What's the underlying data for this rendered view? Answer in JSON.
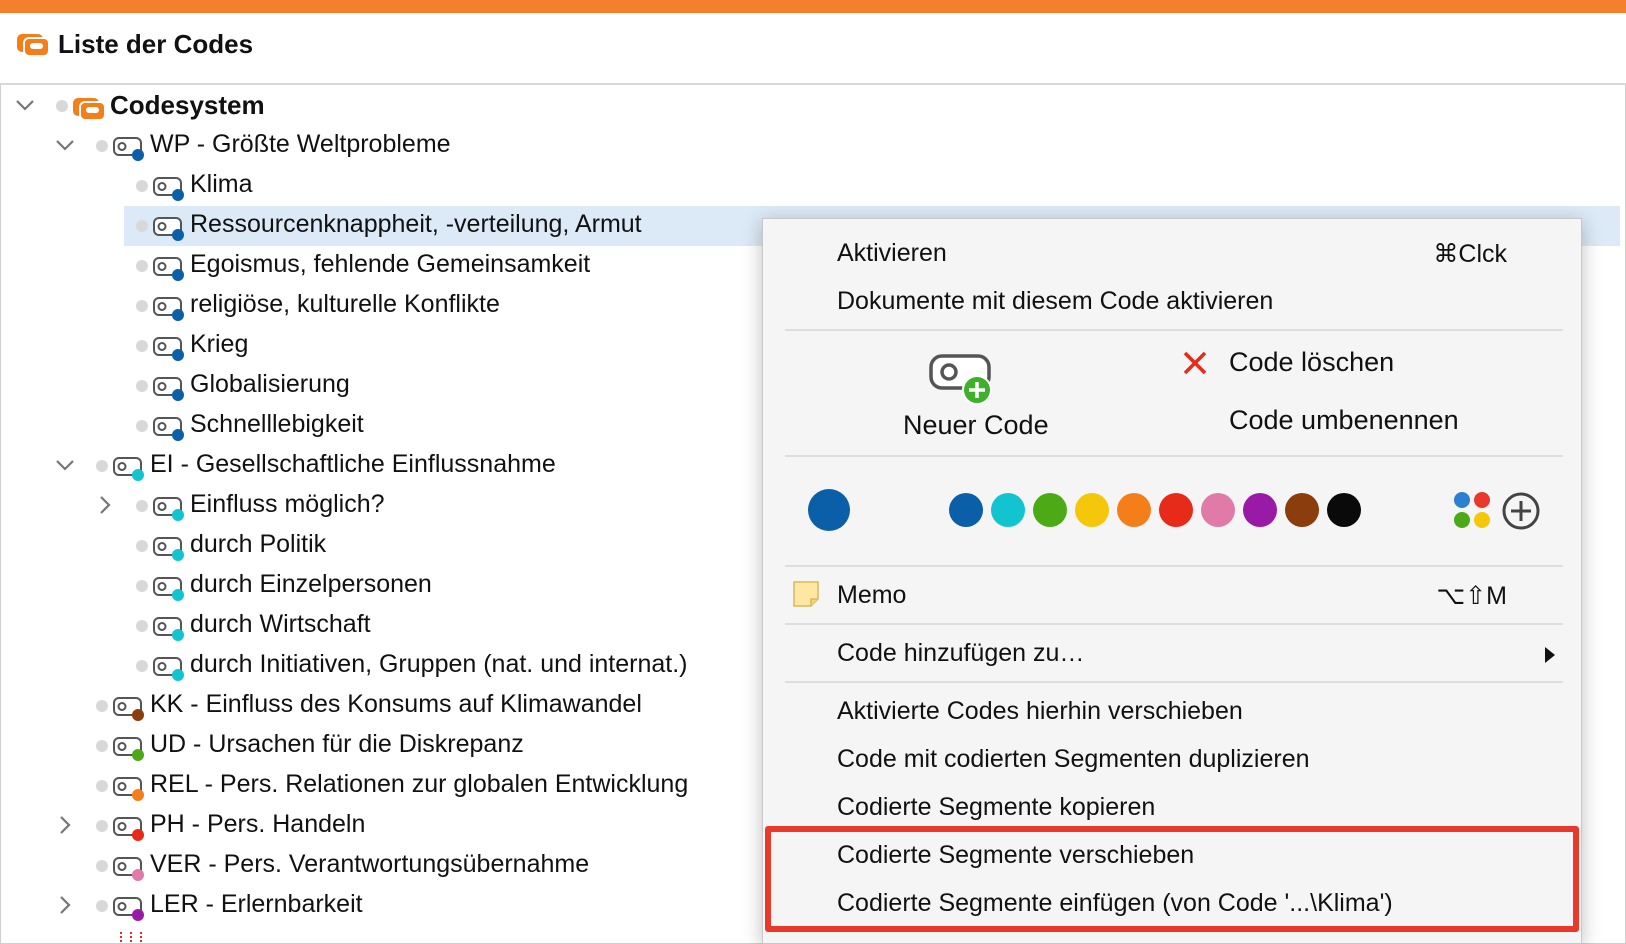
{
  "window": {
    "title": "Liste der Codes"
  },
  "tree": {
    "root": {
      "label": "Codesystem"
    },
    "rows": [
      {
        "label": "WP - Größte Weltprobleme",
        "color": "#0a5fa8"
      },
      {
        "label": "Klima",
        "color": "#0a5fa8"
      },
      {
        "label": "Ressourcenknappheit, -verteilung, Armut",
        "color": "#0a5fa8"
      },
      {
        "label": "Egoismus, fehlende Gemeinsamkeit",
        "color": "#0a5fa8"
      },
      {
        "label": "religiöse, kulturelle Konflikte",
        "color": "#0a5fa8"
      },
      {
        "label": "Krieg",
        "color": "#0a5fa8"
      },
      {
        "label": "Globalisierung",
        "color": "#0a5fa8"
      },
      {
        "label": "Schnelllebigkeit",
        "color": "#0a5fa8"
      },
      {
        "label": "EI - Gesellschaftliche Einflussnahme",
        "color": "#12c4d0"
      },
      {
        "label": "Einfluss möglich?",
        "color": "#12c4d0"
      },
      {
        "label": "durch Politik",
        "color": "#12c4d0"
      },
      {
        "label": "durch Einzelpersonen",
        "color": "#12c4d0"
      },
      {
        "label": "durch Wirtschaft",
        "color": "#12c4d0"
      },
      {
        "label": "durch Initiativen, Gruppen (nat. und internat.)",
        "color": "#12c4d0"
      },
      {
        "label": "KK - Einfluss des Konsums auf Klimawandel",
        "color": "#8b3d0c"
      },
      {
        "label": "UD - Ursachen für die Diskrepanz",
        "color": "#4caa16"
      },
      {
        "label": "REL - Pers. Relationen zur globalen Entwicklung",
        "color": "#f47f1a"
      },
      {
        "label": "PH - Pers. Handeln",
        "color": "#e82a1a"
      },
      {
        "label": "VER - Pers. Verantwortungsübernahme",
        "color": "#e07aa8"
      },
      {
        "label": "LER - Erlernbarkeit",
        "color": "#9a1aa8"
      }
    ]
  },
  "context_menu": {
    "activate": {
      "label": "Aktivieren",
      "shortcut": "⌘Clck"
    },
    "activate_docs": "Dokumente mit diesem Code aktivieren",
    "new_code": "Neuer Code",
    "delete_code": "Code löschen",
    "rename_code": "Code umbenennen",
    "current_color": "#0a5fa8",
    "colors": [
      "#0a5fa8",
      "#12c4d0",
      "#4caa16",
      "#f5c70a",
      "#f47f1a",
      "#e82a1a",
      "#e07aa8",
      "#9a1aa8",
      "#8b3d0c",
      "#0a0a0a"
    ],
    "memo": {
      "label": "Memo",
      "shortcut": "⌥⇧M"
    },
    "add_code_to": "Code hinzufügen zu…",
    "move_activated": "Aktivierte Codes hierhin verschieben",
    "duplicate": "Code mit codierten Segmenten duplizieren",
    "copy_segments": "Codierte Segmente kopieren",
    "move_segments": "Codierte Segmente verschieben",
    "paste_segments": "Codierte Segmente einfügen (von Code '...\\Klima')"
  }
}
